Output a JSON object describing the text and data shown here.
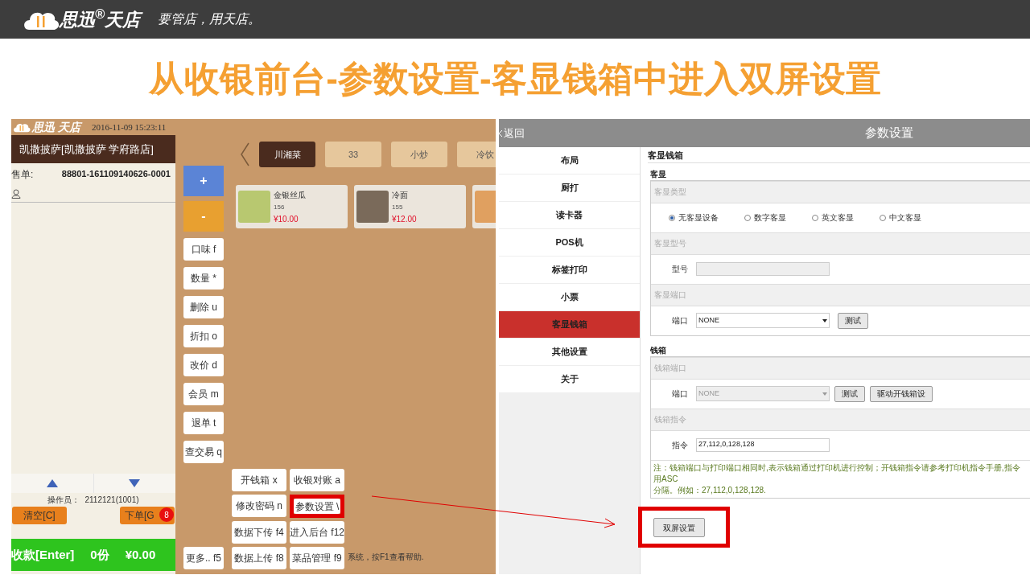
{
  "header": {
    "brand": "思迅$^{®}$天店",
    "slogan": "要管店，用天店。"
  },
  "title": "从收银前台-参数设置-客显钱箱中进入双屏设置",
  "pos": {
    "logo": "思迅 天店",
    "datetime": "2016-11-09 15:23:11",
    "store": "凯撒披萨[凯撒披萨 学府路店]",
    "order_label": "售单:",
    "order_no": "88801-161109140626-0001",
    "categories": [
      {
        "label": "川湘菜",
        "selected": true
      },
      {
        "label": "33",
        "selected": false
      },
      {
        "label": "小炒",
        "selected": false
      },
      {
        "label": "冷饮",
        "selected": false
      }
    ],
    "dishes": [
      {
        "name": "金银丝瓜",
        "code": "156",
        "price": "¥10.00"
      },
      {
        "name": "冷面",
        "code": "155",
        "price": "¥12.00"
      }
    ],
    "side_buttons": [
      {
        "kind": "plus",
        "label": "+"
      },
      {
        "kind": "minus",
        "label": "-"
      },
      {
        "kind": "text",
        "label": "口味 f"
      },
      {
        "kind": "text",
        "label": "数量 *"
      },
      {
        "kind": "text",
        "label": "删除 u"
      },
      {
        "kind": "text",
        "label": "折扣 o"
      },
      {
        "kind": "text",
        "label": "改价 d"
      },
      {
        "kind": "text",
        "label": "会员 m"
      },
      {
        "kind": "text",
        "label": "退单 t"
      },
      {
        "kind": "text",
        "label": "查交易 q"
      }
    ],
    "more_button": "更多.. f5",
    "function_buttons": [
      {
        "label": "开钱箱 x",
        "highlighted": false
      },
      {
        "label": "收银对账 a",
        "highlighted": false
      },
      {
        "label": "修改密码 n",
        "highlighted": false
      },
      {
        "label": "参数设置 \\",
        "highlighted": true
      },
      {
        "label": "数据下传 f4",
        "highlighted": false
      },
      {
        "label": "进入后台 f12",
        "highlighted": false
      },
      {
        "label": "数据上传 f8",
        "highlighted": false
      },
      {
        "label": "菜品管理 f9",
        "highlighted": false
      }
    ],
    "status": "系统，按F1查看帮助.",
    "operator_label": "操作员：",
    "operator": "2112121(1001)",
    "clear_button": "清空[C]",
    "order_button": "下单[G",
    "order_badge": "8",
    "pay": {
      "label": "收款[Enter]",
      "count": "0份",
      "total": "¥0.00"
    }
  },
  "settings": {
    "back": "返回",
    "title": "参数设置",
    "menu": [
      {
        "label": "布局",
        "selected": false
      },
      {
        "label": "厨打",
        "selected": false
      },
      {
        "label": "读卡器",
        "selected": false
      },
      {
        "label": "POS机",
        "selected": false
      },
      {
        "label": "标签打印",
        "selected": false
      },
      {
        "label": "小票",
        "selected": false
      },
      {
        "label": "客显钱箱",
        "selected": true
      },
      {
        "label": "其他设置",
        "selected": false
      },
      {
        "label": "关于",
        "selected": false
      }
    ],
    "section": "客显钱箱",
    "display": {
      "title": "客显",
      "type_header": "客显类型",
      "types": [
        {
          "label": "无客显设备",
          "selected": true
        },
        {
          "label": "数字客显",
          "selected": false
        },
        {
          "label": "英文客显",
          "selected": false
        },
        {
          "label": "中文客显",
          "selected": false
        }
      ],
      "model_header": "客显型号",
      "model_label": "型号",
      "port_header": "客显端口",
      "port_label": "端口",
      "port_value": "NONE",
      "test_button": "测试"
    },
    "drawer": {
      "title": "钱箱",
      "port_header": "钱箱端口",
      "port_label": "端口",
      "port_value": "NONE",
      "test_button": "测试",
      "driver_button": "驱动开钱箱设",
      "command_header": "钱箱指令",
      "command_label": "指令",
      "command_value": "27,112,0,128,128",
      "note": "注：钱箱端口与打印端口相同时,表示钱箱通过打印机进行控制；开钱箱指令请参考打印机指令手册,指令用ASC",
      "note_2": "分隔。例如：27,112,0,128,128."
    },
    "dual_screen": {
      "label": "双屏设置",
      "highlighted": true
    }
  }
}
